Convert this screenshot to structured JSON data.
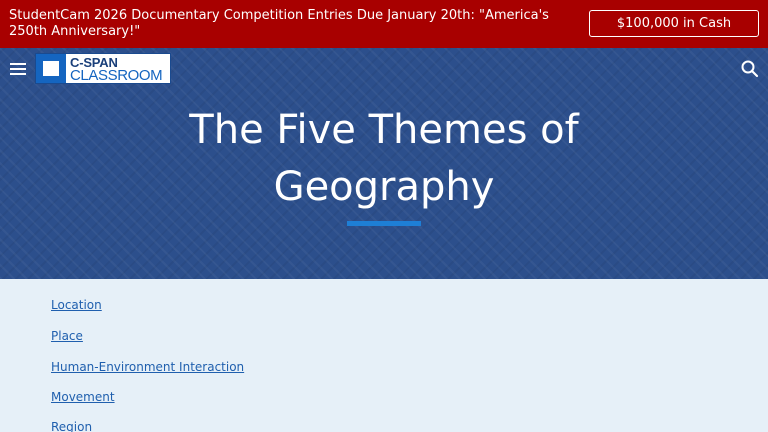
{
  "promo": {
    "text": "StudentCam 2026 Documentary Competition Entries Due January 20th: \"America's 250th Anniversary!\"",
    "button_label": "$100,000 in Cash"
  },
  "header": {
    "menu_icon": "hamburger-menu-icon",
    "logo_top": "C-SPAN",
    "logo_bottom": "CLASSROOM",
    "search_icon": "search-icon"
  },
  "hero": {
    "title": "The Five Themes of Geography"
  },
  "toc": {
    "links": [
      "Location",
      "Place",
      "Human-Environment Interaction",
      "Movement",
      "Region"
    ]
  },
  "colors": {
    "promo_bg": "#a80000",
    "hero_bg": "#2c4f8c",
    "accent_rule": "#1e7fd6",
    "link": "#1f5fae",
    "page_bg": "#e6f0f8"
  }
}
